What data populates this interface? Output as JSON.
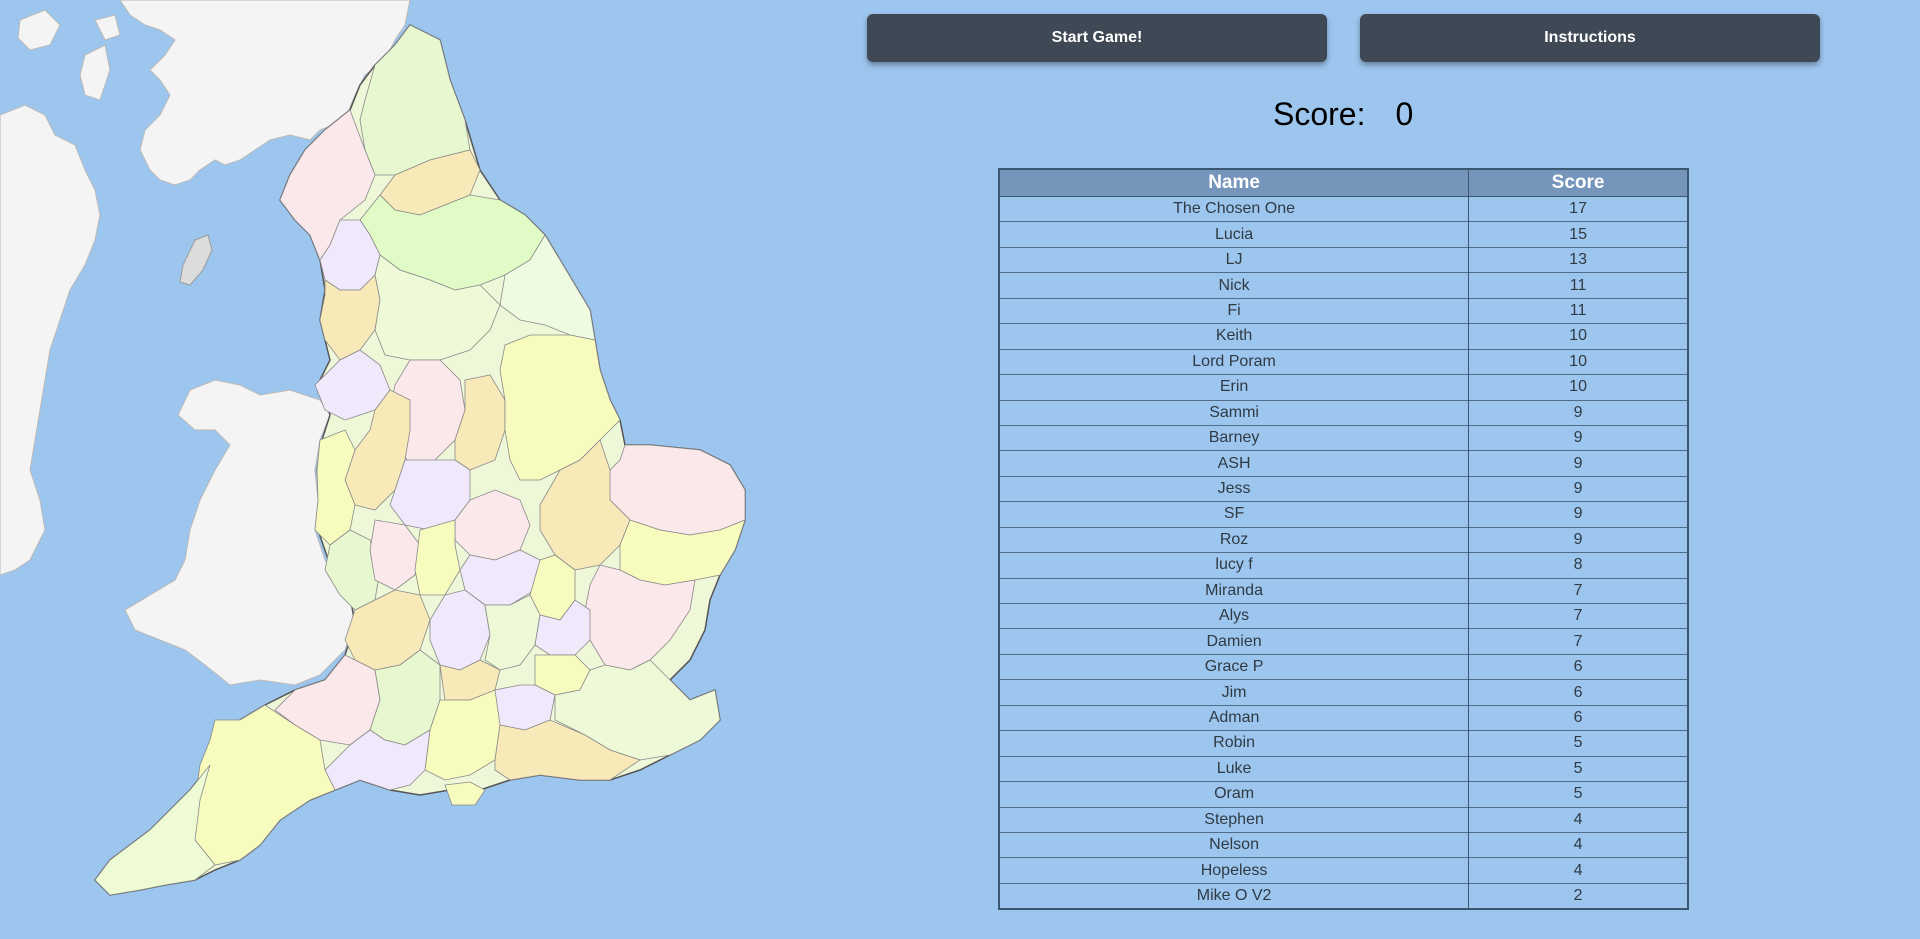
{
  "buttons": {
    "start_label": "Start Game!",
    "instructions_label": "Instructions"
  },
  "score": {
    "label": "Score:",
    "value": "0"
  },
  "leaderboard": {
    "headers": {
      "name": "Name",
      "score": "Score"
    },
    "rows": [
      {
        "name": "The Chosen One",
        "score": "17"
      },
      {
        "name": "Lucia",
        "score": "15"
      },
      {
        "name": "LJ",
        "score": "13"
      },
      {
        "name": "Nick",
        "score": "11"
      },
      {
        "name": "Fi",
        "score": "11"
      },
      {
        "name": "Keith",
        "score": "10"
      },
      {
        "name": "Lord Poram",
        "score": "10"
      },
      {
        "name": "Erin",
        "score": "10"
      },
      {
        "name": "Sammi",
        "score": "9"
      },
      {
        "name": "Barney",
        "score": "9"
      },
      {
        "name": "ASH",
        "score": "9"
      },
      {
        "name": "Jess",
        "score": "9"
      },
      {
        "name": "SF",
        "score": "9"
      },
      {
        "name": "Roz",
        "score": "9"
      },
      {
        "name": "lucy f",
        "score": "8"
      },
      {
        "name": "Miranda",
        "score": "7"
      },
      {
        "name": "Alys",
        "score": "7"
      },
      {
        "name": "Damien",
        "score": "7"
      },
      {
        "name": "Grace P",
        "score": "6"
      },
      {
        "name": "Jim",
        "score": "6"
      },
      {
        "name": "Adman",
        "score": "6"
      },
      {
        "name": "Robin",
        "score": "5"
      },
      {
        "name": "Luke",
        "score": "5"
      },
      {
        "name": "Oram",
        "score": "5"
      },
      {
        "name": "Stephen",
        "score": "4"
      },
      {
        "name": "Nelson",
        "score": "4"
      },
      {
        "name": "Hopeless",
        "score": "4"
      },
      {
        "name": "Mike O V2",
        "score": "2"
      }
    ]
  },
  "colors": {
    "background": "#9dc6ef",
    "button": "#3f4955",
    "table_header": "#7596ba",
    "land_other": "#f4f4f4"
  }
}
